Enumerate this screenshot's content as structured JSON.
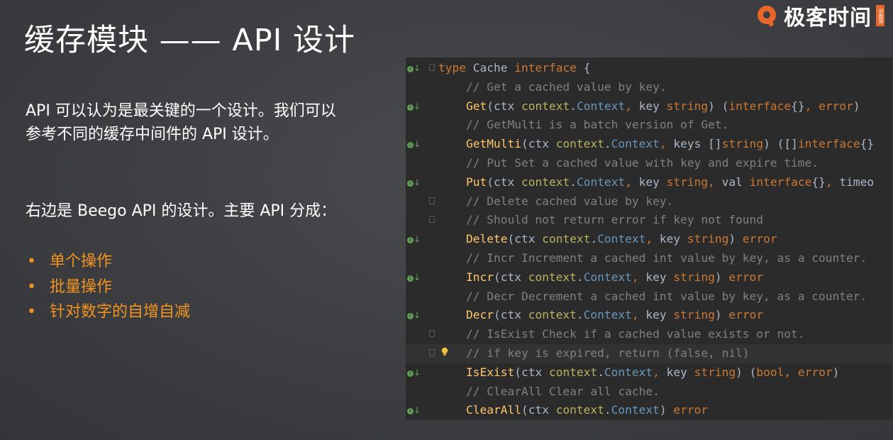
{
  "slide": {
    "title": "缓存模块 —— API 设计",
    "intro": "API 可以认为是最关键的一个设计。我们可以参考不同的缓存中间件的 API 设计。",
    "beego_note": "右边是 Beego API 的设计。主要 API 分成：",
    "bullets": [
      "单个操作",
      "批量操作",
      "针对数字的自增自减"
    ],
    "bullet_marker": "•"
  },
  "logo": {
    "text": "极客时间",
    "badge": "训练营"
  },
  "colors": {
    "accent": "#f3931f",
    "brand": "#e8662a",
    "code_bg": "#2b2b2b"
  },
  "code": {
    "lines": [
      {
        "icon": "implemented-icon",
        "fold": true,
        "tokens": [
          [
            "kw",
            "type "
          ],
          [
            "tx",
            "Cache "
          ],
          [
            "kw",
            "interface "
          ],
          [
            "tx",
            "{"
          ]
        ]
      },
      {
        "tokens": [
          [
            "cm",
            "    // Get a cached value by key."
          ]
        ]
      },
      {
        "icon": "implemented-icon",
        "tokens": [
          [
            "tx",
            "    "
          ],
          [
            "fn",
            "Get"
          ],
          [
            "tx",
            "(ctx "
          ],
          [
            "pk",
            "context"
          ],
          [
            "tx",
            "."
          ],
          [
            "ty",
            "Context"
          ],
          [
            "kw",
            ", "
          ],
          [
            "tx",
            "key "
          ],
          [
            "kw",
            "string"
          ],
          [
            "tx",
            ") ("
          ],
          [
            "kw",
            "interface"
          ],
          [
            "tx",
            "{}"
          ],
          [
            "kw",
            ", "
          ],
          [
            "kw",
            "error"
          ],
          [
            "tx",
            ")"
          ]
        ]
      },
      {
        "tokens": [
          [
            "cm",
            "    // GetMulti is a batch version of Get."
          ]
        ]
      },
      {
        "icon": "implemented-icon",
        "tokens": [
          [
            "tx",
            "    "
          ],
          [
            "fn",
            "GetMulti"
          ],
          [
            "tx",
            "(ctx "
          ],
          [
            "pk",
            "context"
          ],
          [
            "tx",
            "."
          ],
          [
            "ty",
            "Context"
          ],
          [
            "kw",
            ", "
          ],
          [
            "tx",
            "keys []"
          ],
          [
            "kw",
            "string"
          ],
          [
            "tx",
            ") ([]"
          ],
          [
            "kw",
            "interface"
          ],
          [
            "tx",
            "{}"
          ]
        ]
      },
      {
        "tokens": [
          [
            "cm",
            "    // Put Set a cached value with key and expire time."
          ]
        ]
      },
      {
        "icon": "implemented-icon",
        "tokens": [
          [
            "tx",
            "    "
          ],
          [
            "fn",
            "Put"
          ],
          [
            "tx",
            "(ctx "
          ],
          [
            "pk",
            "context"
          ],
          [
            "tx",
            "."
          ],
          [
            "ty",
            "Context"
          ],
          [
            "kw",
            ", "
          ],
          [
            "tx",
            "key "
          ],
          [
            "kw",
            "string"
          ],
          [
            "kw",
            ", "
          ],
          [
            "tx",
            "val "
          ],
          [
            "kw",
            "interface"
          ],
          [
            "tx",
            "{}"
          ],
          [
            "kw",
            ", "
          ],
          [
            "tx",
            "timeo"
          ]
        ]
      },
      {
        "fold": true,
        "tokens": [
          [
            "cm",
            "    // Delete cached value by key."
          ]
        ]
      },
      {
        "fold": true,
        "tokens": [
          [
            "cm",
            "    // Should not return error if key not found"
          ]
        ]
      },
      {
        "icon": "implemented-icon",
        "tokens": [
          [
            "tx",
            "    "
          ],
          [
            "fn",
            "Delete"
          ],
          [
            "tx",
            "(ctx "
          ],
          [
            "pk",
            "context"
          ],
          [
            "tx",
            "."
          ],
          [
            "ty",
            "Context"
          ],
          [
            "kw",
            ", "
          ],
          [
            "tx",
            "key "
          ],
          [
            "kw",
            "string"
          ],
          [
            "tx",
            ") "
          ],
          [
            "kw",
            "error"
          ]
        ]
      },
      {
        "tokens": [
          [
            "cm",
            "    // Incr Increment a cached int value by key, as a counter."
          ]
        ]
      },
      {
        "icon": "implemented-icon",
        "tokens": [
          [
            "tx",
            "    "
          ],
          [
            "fn",
            "Incr"
          ],
          [
            "tx",
            "(ctx "
          ],
          [
            "pk",
            "context"
          ],
          [
            "tx",
            "."
          ],
          [
            "ty",
            "Context"
          ],
          [
            "kw",
            ", "
          ],
          [
            "tx",
            "key "
          ],
          [
            "kw",
            "string"
          ],
          [
            "tx",
            ") "
          ],
          [
            "kw",
            "error"
          ]
        ]
      },
      {
        "tokens": [
          [
            "cm",
            "    // Decr Decrement a cached int value by key, as a counter."
          ]
        ]
      },
      {
        "icon": "implemented-icon",
        "tokens": [
          [
            "tx",
            "    "
          ],
          [
            "fn",
            "Decr"
          ],
          [
            "tx",
            "(ctx "
          ],
          [
            "pk",
            "context"
          ],
          [
            "tx",
            "."
          ],
          [
            "ty",
            "Context"
          ],
          [
            "kw",
            ", "
          ],
          [
            "tx",
            "key "
          ],
          [
            "kw",
            "string"
          ],
          [
            "tx",
            ") "
          ],
          [
            "kw",
            "error"
          ]
        ]
      },
      {
        "fold": true,
        "tokens": [
          [
            "cm",
            "    // IsExist Check if a cached value exists or not."
          ]
        ]
      },
      {
        "fold": true,
        "bulb": true,
        "highlight": true,
        "tokens": [
          [
            "cm",
            "    // if key is expired, return (false, nil)"
          ]
        ]
      },
      {
        "icon": "implemented-icon",
        "tokens": [
          [
            "tx",
            "    "
          ],
          [
            "fn",
            "IsExist"
          ],
          [
            "tx",
            "(ctx "
          ],
          [
            "pk",
            "context"
          ],
          [
            "tx",
            "."
          ],
          [
            "ty",
            "Context"
          ],
          [
            "kw",
            ", "
          ],
          [
            "tx",
            "key "
          ],
          [
            "kw",
            "string"
          ],
          [
            "tx",
            ") ("
          ],
          [
            "kw",
            "bool"
          ],
          [
            "kw",
            ", "
          ],
          [
            "kw",
            "error"
          ],
          [
            "tx",
            ")"
          ]
        ]
      },
      {
        "tokens": [
          [
            "cm",
            "    // ClearAll Clear all cache."
          ]
        ]
      },
      {
        "icon": "implemented-icon",
        "tokens": [
          [
            "tx",
            "    "
          ],
          [
            "fn",
            "ClearAll"
          ],
          [
            "tx",
            "(ctx "
          ],
          [
            "pk",
            "context"
          ],
          [
            "tx",
            "."
          ],
          [
            "ty",
            "Context"
          ],
          [
            "tx",
            ") "
          ],
          [
            "kw",
            "error"
          ]
        ]
      }
    ]
  }
}
